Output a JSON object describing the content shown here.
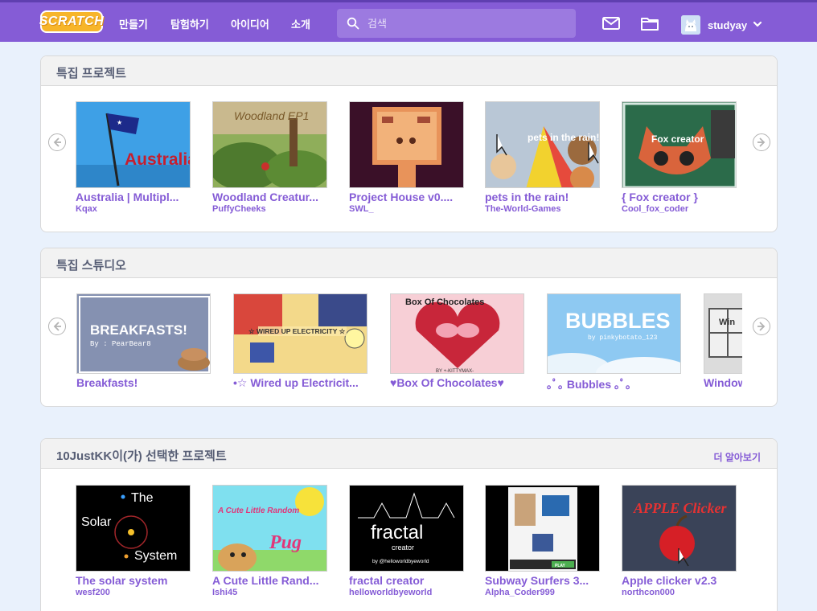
{
  "topbar": {
    "logo": "SCRATCH",
    "nav": [
      "만들기",
      "탐험하기",
      "아이디어",
      "소개"
    ],
    "search_placeholder": "검색",
    "username": "studyay"
  },
  "featured_projects": {
    "title": "특집 프로젝트",
    "items": [
      {
        "title": "Australia | Multipl...",
        "author": "Kqax",
        "thumb_text": "Australia Art"
      },
      {
        "title": "Woodland Creatur...",
        "author": "PuffyCheeks",
        "thumb_text": "Woodland EP1"
      },
      {
        "title": "Project House v0....",
        "author": "SWL_"
      },
      {
        "title": "pets in the rain!",
        "author": "The-World-Games",
        "thumb_text": "pets in the rain!"
      },
      {
        "title": "{ Fox creator }",
        "author": "Cool_fox_coder",
        "thumb_text": "Fox creator"
      }
    ]
  },
  "featured_studios": {
    "title": "특집 스튜디오",
    "items": [
      {
        "title": "Breakfasts!",
        "thumb_text": "BREAKFASTS!",
        "thumb_sub": "By : PearBear8"
      },
      {
        "title": "•☆ Wired up Electricit...",
        "thumb_text": "☆ WIRED UP ELECTRICITY ☆"
      },
      {
        "title": "♥Box Of Chocolates♥",
        "thumb_text": "Box Of Chocolates",
        "thumb_sub": "BY +-KITTYMAX-"
      },
      {
        "title": "｡ﾟ｡ Bubbles ｡ﾟ｡",
        "thumb_text": "BUBBLES",
        "thumb_sub": "by pinkybotato_123"
      },
      {
        "title": "Window",
        "thumb_text": "Win"
      }
    ]
  },
  "curated": {
    "title": "10JustKK이(가) 선택한 프로젝트",
    "more": "더 알아보기",
    "items": [
      {
        "title": "The solar system",
        "author": "wesf200",
        "thumb_text": "Solar",
        "thumb_text2": "The",
        "thumb_text3": "System"
      },
      {
        "title": "A Cute Little Rand...",
        "author": "Ishi45",
        "thumb_text": "A Cute Little Random",
        "thumb_text2": "Pug"
      },
      {
        "title": "fractal creator",
        "author": "helloworldbyeworld",
        "thumb_text": "fractal",
        "thumb_text2": "creator",
        "thumb_text3": "by @helloworldbyeworld"
      },
      {
        "title": "Subway Surfers 3...",
        "author": "Alpha_Coder999",
        "thumb_text": "PLAY"
      },
      {
        "title": "Apple clicker v2.3",
        "author": "northcon000",
        "thumb_text": "APPLE Clicker"
      }
    ]
  },
  "colors": {
    "brand": "#855cd6",
    "background": "#e9f1fc",
    "title_text": "#575e75"
  }
}
